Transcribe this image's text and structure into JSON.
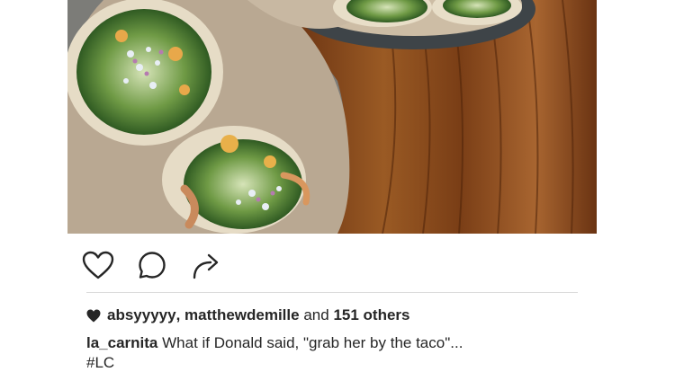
{
  "post": {
    "image_alt": "",
    "actions": [
      {
        "name": "like",
        "icon": "heart-outline-icon"
      },
      {
        "name": "comment",
        "icon": "comment-bubble-icon"
      },
      {
        "name": "share",
        "icon": "share-arrow-icon"
      }
    ],
    "likes": {
      "icon": "heart-filled-icon",
      "user1": "absyyyyy",
      "separator": ",",
      "user2": "matthewdemille",
      "and_text": "and",
      "others": "151 others"
    },
    "caption": {
      "username": "la_carnita",
      "text": "What if Donald said, \"grab her by the taco\"...",
      "hashtags": "#LC"
    }
  },
  "colors": {
    "text": "#262626",
    "divider": "#dbdbdb",
    "wood": "#8a4a1c",
    "paper": "#b8a690"
  }
}
